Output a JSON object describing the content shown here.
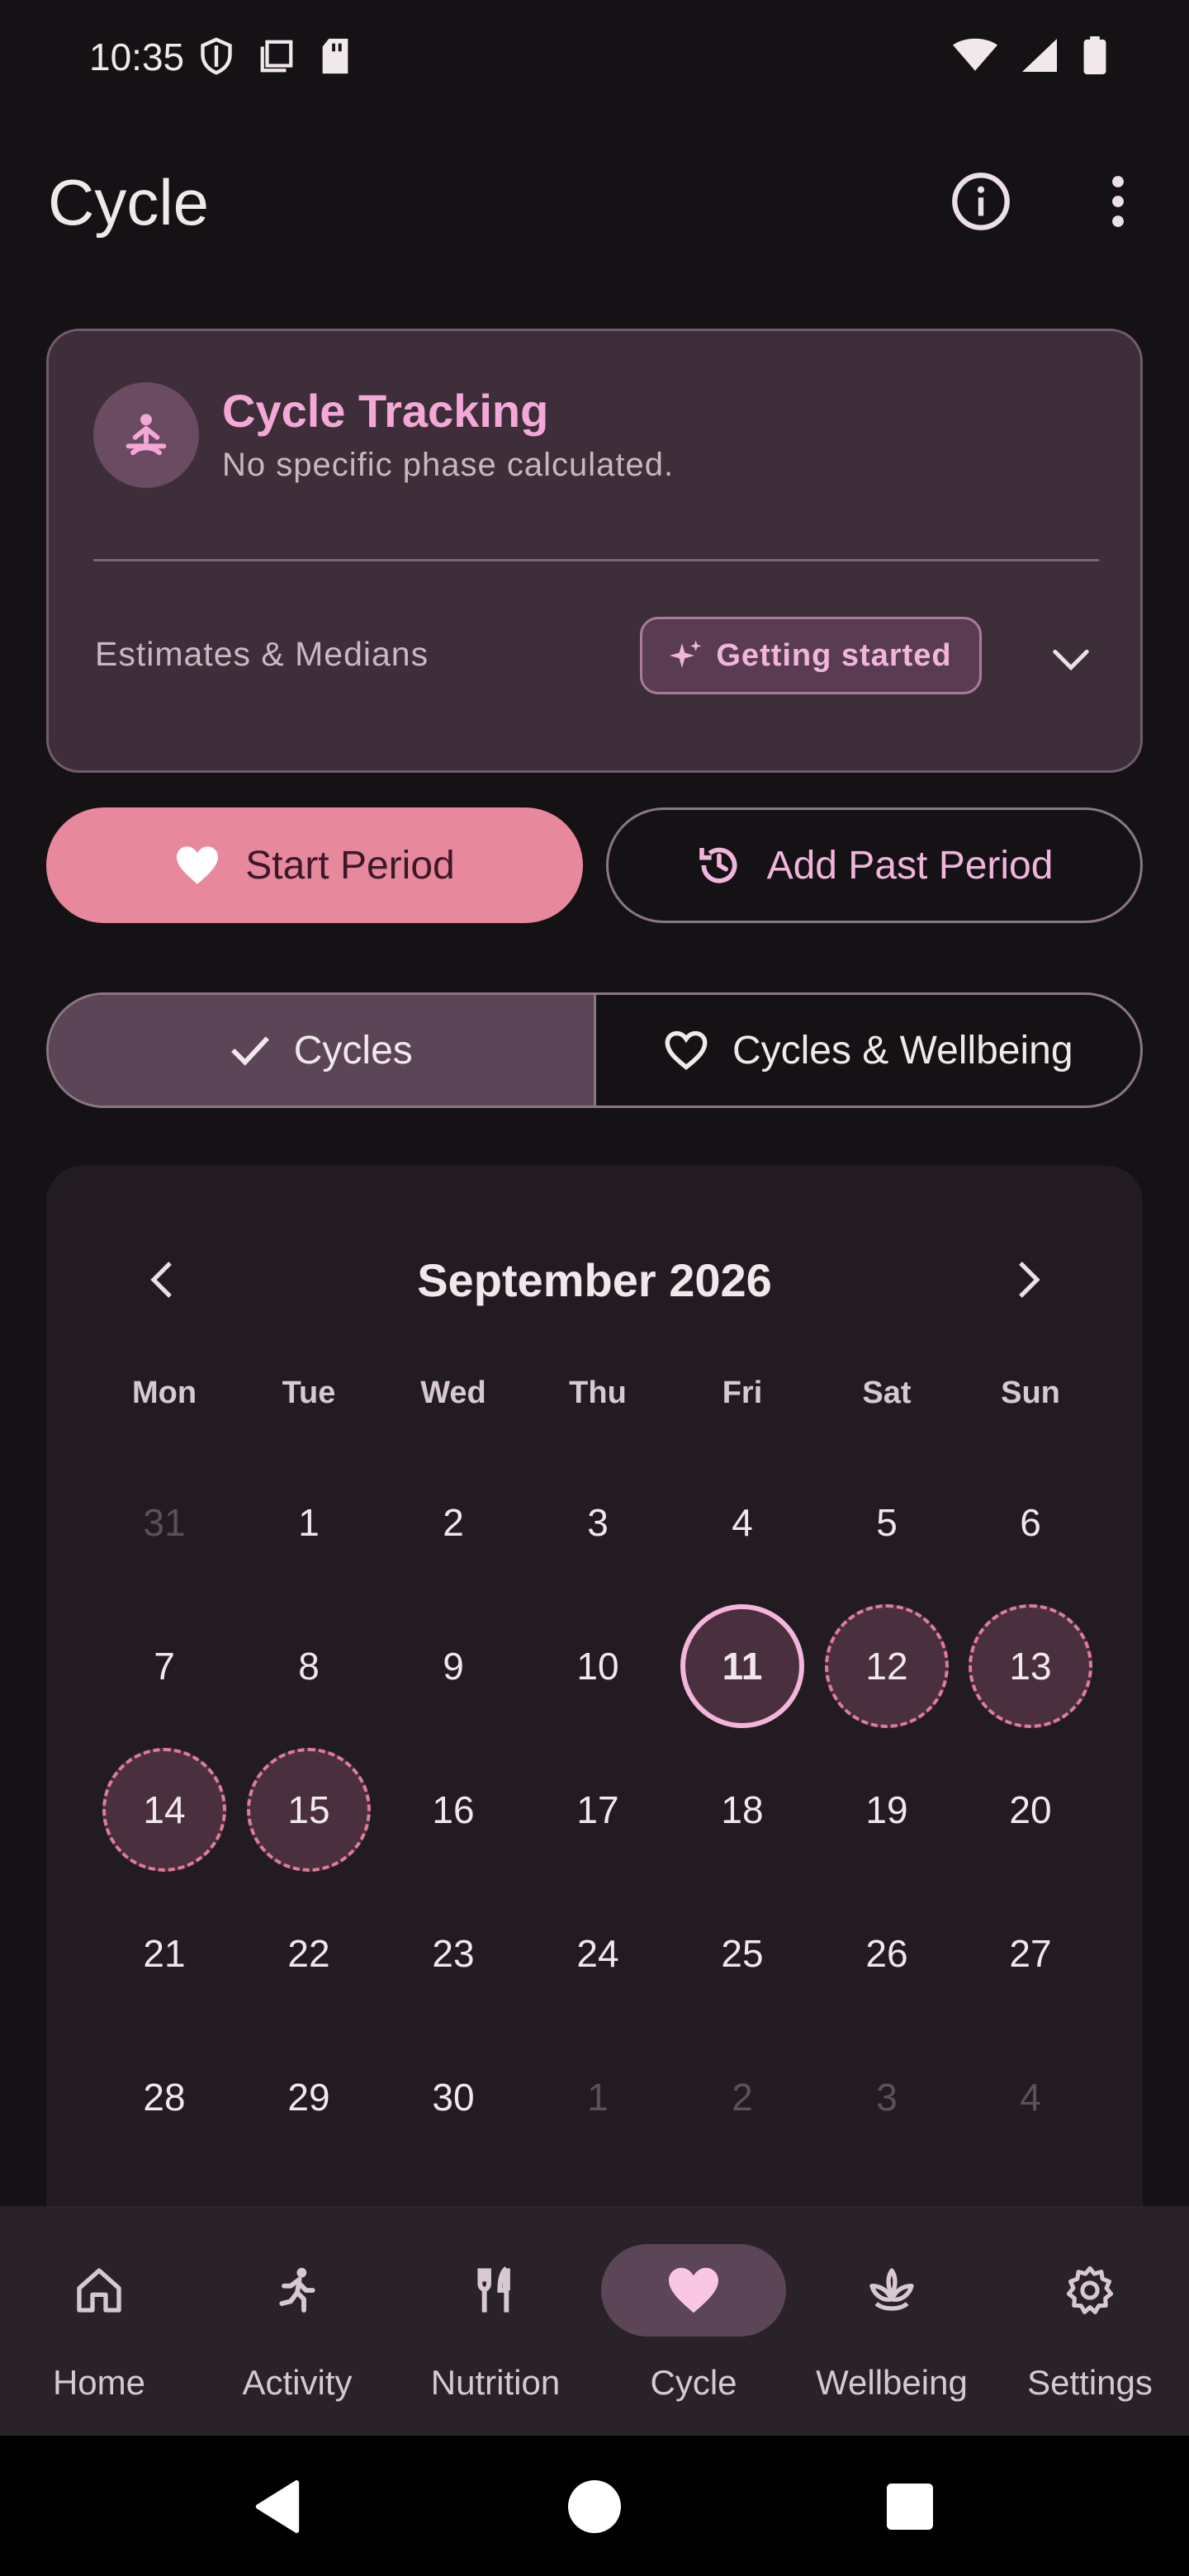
{
  "status_bar": {
    "time": "10:35"
  },
  "app_bar": {
    "title": "Cycle",
    "info_icon": "info-icon",
    "more_icon": "more-vertical-icon"
  },
  "tracking_card": {
    "title": "Cycle Tracking",
    "subtitle": "No specific phase calculated.",
    "estimates_label": "Estimates & Medians",
    "chip_label": "Getting started"
  },
  "actions": {
    "start_period": "Start Period",
    "add_past_period": "Add Past Period"
  },
  "view_toggle": {
    "cycles": "Cycles",
    "cycles_wellbeing": "Cycles & Wellbeing",
    "selected": "Cycles"
  },
  "calendar": {
    "month_label": "September 2026",
    "weekdays": [
      "Mon",
      "Tue",
      "Wed",
      "Thu",
      "Fri",
      "Sat",
      "Sun"
    ],
    "weeks": [
      [
        {
          "d": "31",
          "m": true
        },
        {
          "d": "1"
        },
        {
          "d": "2"
        },
        {
          "d": "3"
        },
        {
          "d": "4"
        },
        {
          "d": "5"
        },
        {
          "d": "6"
        }
      ],
      [
        {
          "d": "7"
        },
        {
          "d": "8"
        },
        {
          "d": "9"
        },
        {
          "d": "10"
        },
        {
          "d": "11",
          "today": true
        },
        {
          "d": "12",
          "predicted": true
        },
        {
          "d": "13",
          "predicted": true
        }
      ],
      [
        {
          "d": "14",
          "predicted": true
        },
        {
          "d": "15",
          "predicted": true
        },
        {
          "d": "16"
        },
        {
          "d": "17"
        },
        {
          "d": "18"
        },
        {
          "d": "19"
        },
        {
          "d": "20"
        }
      ],
      [
        {
          "d": "21"
        },
        {
          "d": "22"
        },
        {
          "d": "23"
        },
        {
          "d": "24"
        },
        {
          "d": "25"
        },
        {
          "d": "26"
        },
        {
          "d": "27"
        }
      ],
      [
        {
          "d": "28"
        },
        {
          "d": "29"
        },
        {
          "d": "30"
        },
        {
          "d": "1",
          "m": true
        },
        {
          "d": "2",
          "m": true
        },
        {
          "d": "3",
          "m": true
        },
        {
          "d": "4",
          "m": true
        }
      ]
    ]
  },
  "bottom_nav": {
    "items": [
      {
        "label": "Home",
        "icon": "home-icon"
      },
      {
        "label": "Activity",
        "icon": "running-icon"
      },
      {
        "label": "Nutrition",
        "icon": "fork-knife-icon"
      },
      {
        "label": "Cycle",
        "icon": "heart-icon",
        "active": true
      },
      {
        "label": "Wellbeing",
        "icon": "lotus-icon"
      },
      {
        "label": "Settings",
        "icon": "gear-icon"
      }
    ]
  },
  "colors": {
    "accent_pink": "#f4a8d8",
    "button_pink": "#e8889c",
    "card_bg": "#3d2e3a",
    "predicted_border": "#e07c98"
  }
}
